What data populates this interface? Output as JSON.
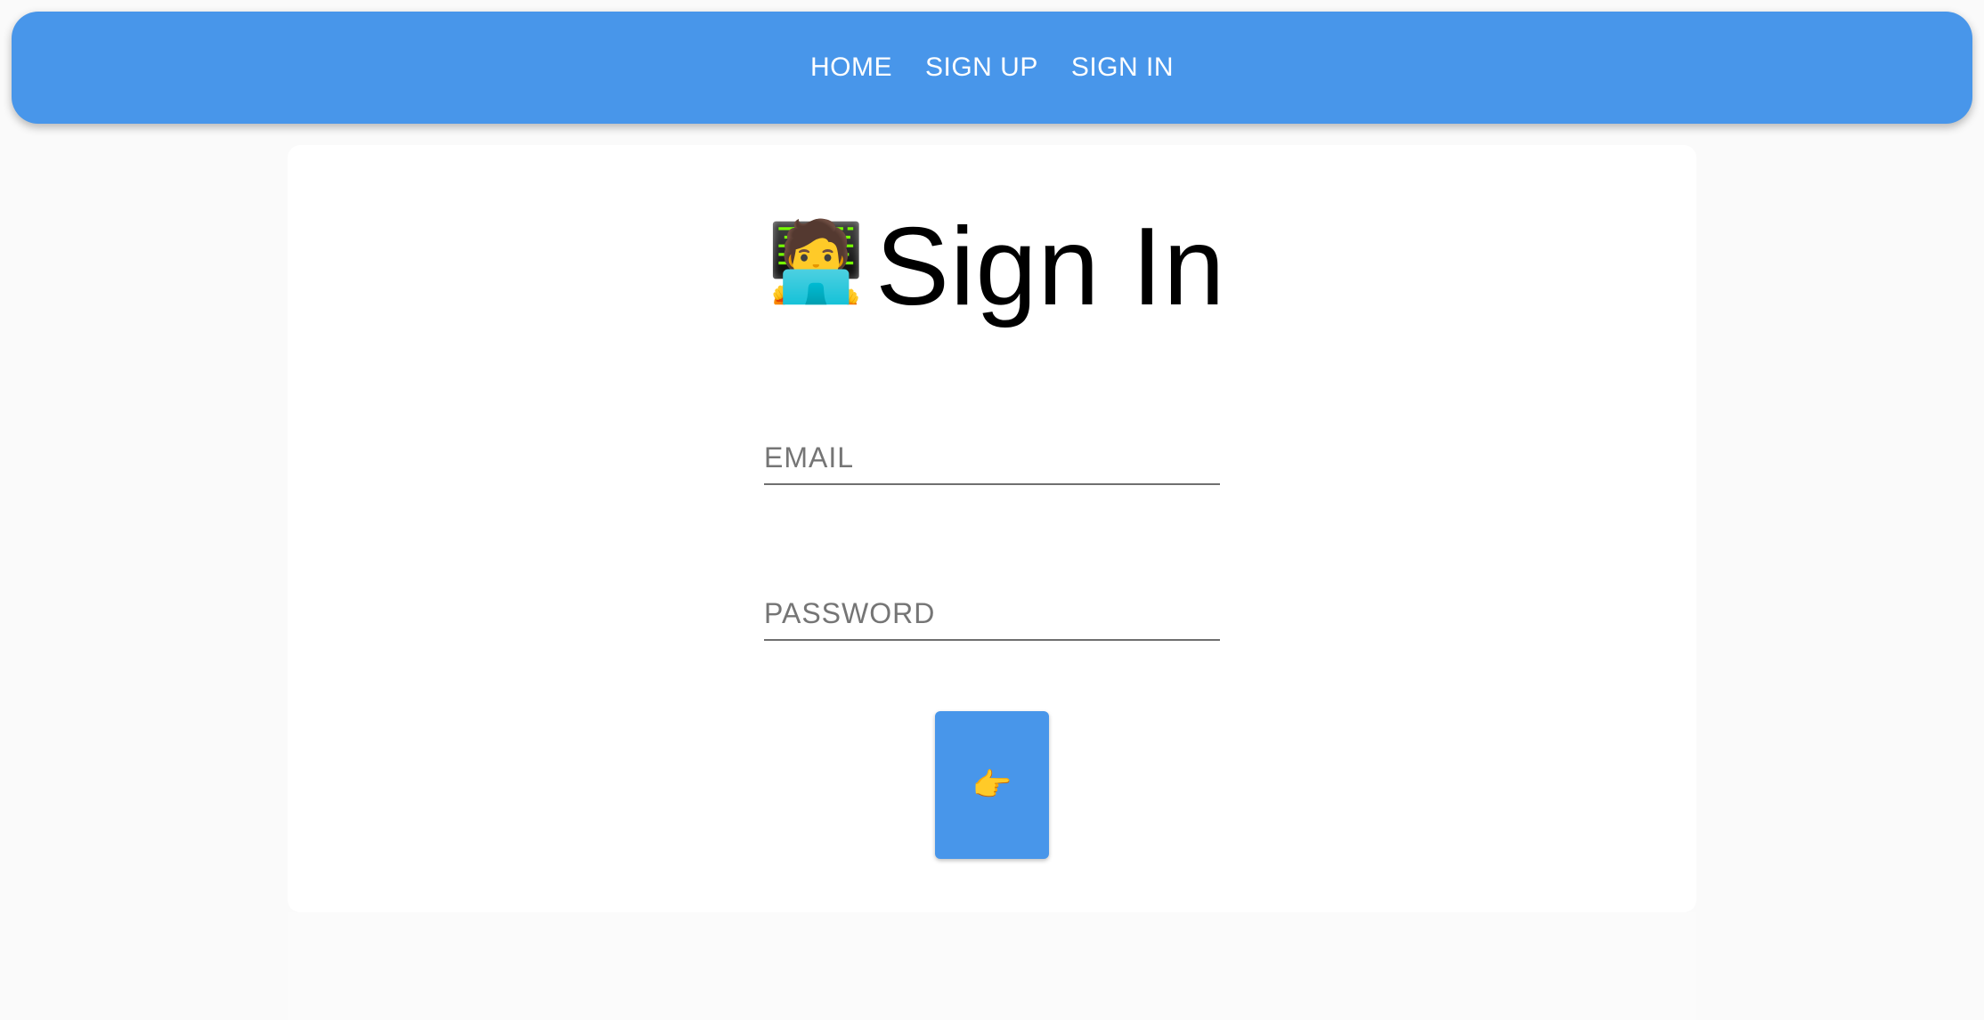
{
  "nav": {
    "items": [
      {
        "label": "HOME"
      },
      {
        "label": "SIGN UP"
      },
      {
        "label": "SIGN IN"
      }
    ]
  },
  "title": {
    "icon": "technologist-emoji",
    "icon_glyph": "🧑‍💻",
    "text": "Sign In"
  },
  "form": {
    "email_placeholder": "EMAIL",
    "email_value": "",
    "password_placeholder": "PASSWORD",
    "password_value": "",
    "submit_icon": "pointing-right-emoji",
    "submit_glyph": "👉"
  },
  "colors": {
    "primary": "#4896ea",
    "background": "#fafafa",
    "card": "#ffffff"
  }
}
